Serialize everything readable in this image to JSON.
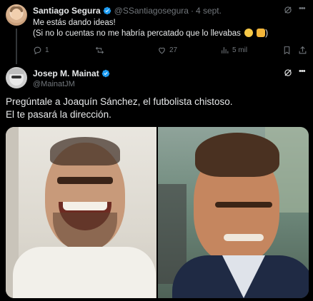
{
  "tweet1": {
    "author_name": "Santiago Segura",
    "handle": "@SSantiagosegura",
    "separator": "·",
    "date": "4 sept.",
    "line1": "Me estás dando ideas!",
    "line2": "(Si no lo cuentas no me habría percatado que lo llevabas",
    "emojis": [
      "grinning-squinting-face",
      "thumbs-up"
    ],
    "actions": {
      "replies": "1",
      "reposts": "",
      "likes": "27",
      "views": "5 mil"
    }
  },
  "tweet2": {
    "author_name": "Josep M. Mainat",
    "handle": "@MainatJM",
    "text_line1": "Pregúntale a Joaquín Sánchez, el futbolista chistoso.",
    "text_line2": "El te pasará la dirección."
  },
  "colors": {
    "background": "#000000",
    "text": "#e7e9ea",
    "muted": "#71767b",
    "verified": "#1d9bf0"
  }
}
